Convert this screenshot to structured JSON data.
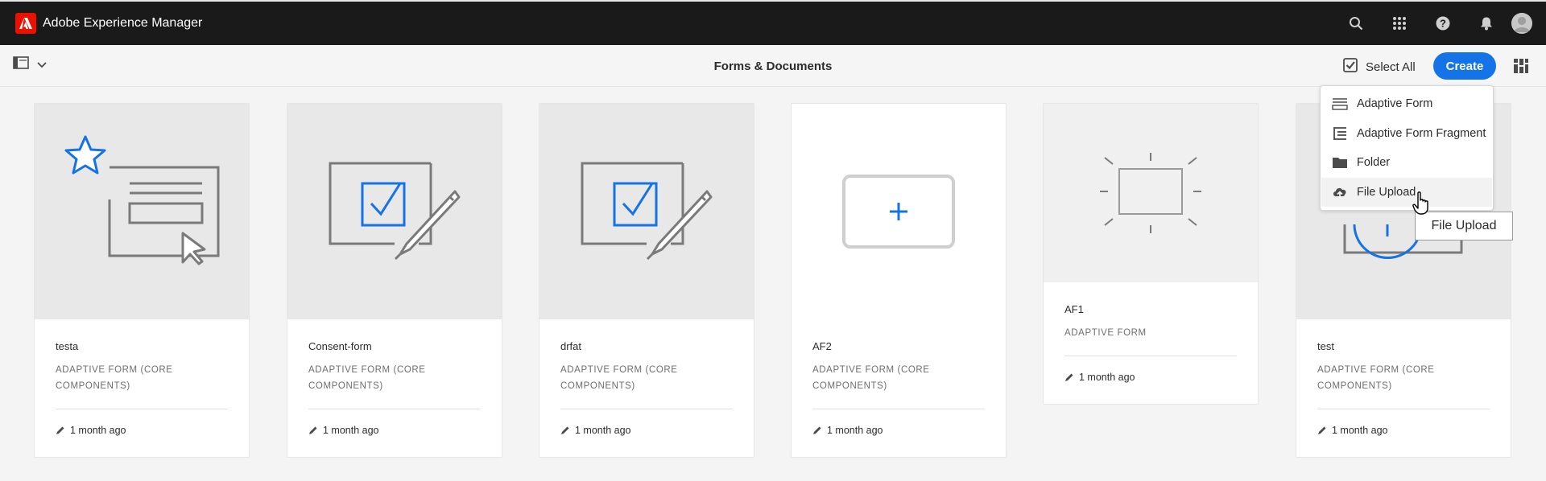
{
  "shell": {
    "app_title": "Adobe Experience Manager",
    "icons": [
      "search-icon",
      "apps-grid-icon",
      "help-icon",
      "notifications-bell-icon",
      "user-avatar"
    ]
  },
  "actionbar": {
    "page_title": "Forms & Documents",
    "select_all_label": "Select All",
    "create_label": "Create"
  },
  "create_menu": {
    "items": [
      {
        "label": "Adaptive Form",
        "icon": "adaptive-form-icon"
      },
      {
        "label": "Adaptive Form Fragment",
        "icon": "form-fragment-icon"
      },
      {
        "label": "Folder",
        "icon": "folder-icon"
      },
      {
        "label": "File Upload",
        "icon": "cloud-upload-icon"
      }
    ],
    "tooltip": "File Upload"
  },
  "cards": [
    {
      "title": "testa",
      "type": "ADAPTIVE FORM (CORE COMPONENTS)",
      "modified": "1 month ago",
      "thumbnail": "form-template-star-icon"
    },
    {
      "title": "Consent-form",
      "type": "ADAPTIVE FORM (CORE COMPONENTS)",
      "modified": "1 month ago",
      "thumbnail": "form-check-pen-icon"
    },
    {
      "title": "drfat",
      "type": "ADAPTIVE FORM (CORE COMPONENTS)",
      "modified": "1 month ago",
      "thumbnail": "form-check-pen-icon"
    },
    {
      "title": "AF2",
      "type": "ADAPTIVE FORM (CORE COMPONENTS)",
      "modified": "1 month ago",
      "thumbnail": "add-form-icon"
    },
    {
      "title": "AF1",
      "type": "ADAPTIVE FORM",
      "modified": "1 month ago",
      "thumbnail": "blank-form-spark-icon"
    },
    {
      "title": "test",
      "type": "ADAPTIVE FORM (CORE COMPONENTS)",
      "modified": "1 month ago",
      "thumbnail": "upload-form-icon"
    }
  ],
  "colors": {
    "accent": "#1473e6",
    "shell_bg": "#1a1a1a",
    "adobe_red": "#eb1000"
  }
}
